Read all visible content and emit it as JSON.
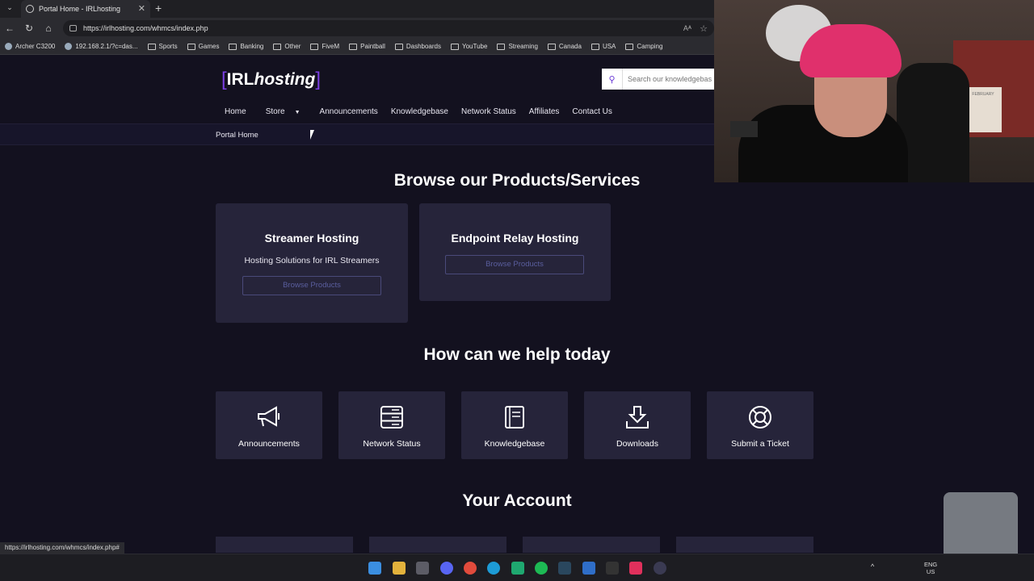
{
  "browser": {
    "tab_title": "Portal Home - IRLhosting",
    "url": "https://irlhosting.com/whmcs/index.php",
    "bookmarks": [
      "Archer C3200",
      "192.168.2.1/?c=das...",
      "Sports",
      "Games",
      "Banking",
      "Other",
      "FiveM",
      "Paintball",
      "Dashboards",
      "YouTube",
      "Streaming",
      "Canada",
      "USA",
      "Camping"
    ],
    "status_url": "https://irlhosting.com/whmcs/index.php#"
  },
  "site": {
    "logo_main": "IRL",
    "logo_sub": "hosting",
    "search_placeholder": "Search our knowledgebase...",
    "nav": [
      "Home",
      "Store",
      "Announcements",
      "Knowledgebase",
      "Network Status",
      "Affiliates",
      "Contact Us"
    ],
    "breadcrumb": "Portal Home"
  },
  "products": {
    "heading": "Browse our Products/Services",
    "items": [
      {
        "title": "Streamer Hosting",
        "desc": "Hosting Solutions for IRL Streamers",
        "button": "Browse Products"
      },
      {
        "title": "Endpoint Relay Hosting",
        "desc": "",
        "button": "Browse Products"
      }
    ]
  },
  "help": {
    "heading": "How can we help today",
    "items": [
      {
        "label": "Announcements",
        "icon": "megaphone-icon"
      },
      {
        "label": "Network Status",
        "icon": "server-icon"
      },
      {
        "label": "Knowledgebase",
        "icon": "book-icon"
      },
      {
        "label": "Downloads",
        "icon": "download-icon"
      },
      {
        "label": "Submit a Ticket",
        "icon": "lifebuoy-icon"
      }
    ]
  },
  "account": {
    "heading": "Your Account"
  },
  "overlay": {
    "calendar_text": "FEBRUARY"
  },
  "taskbar": {
    "lang_1": "ENG",
    "lang_2": "US"
  },
  "colors": {
    "page_bg": "#13111f",
    "card_bg": "#26243a",
    "accent": "#7b3fe4"
  }
}
